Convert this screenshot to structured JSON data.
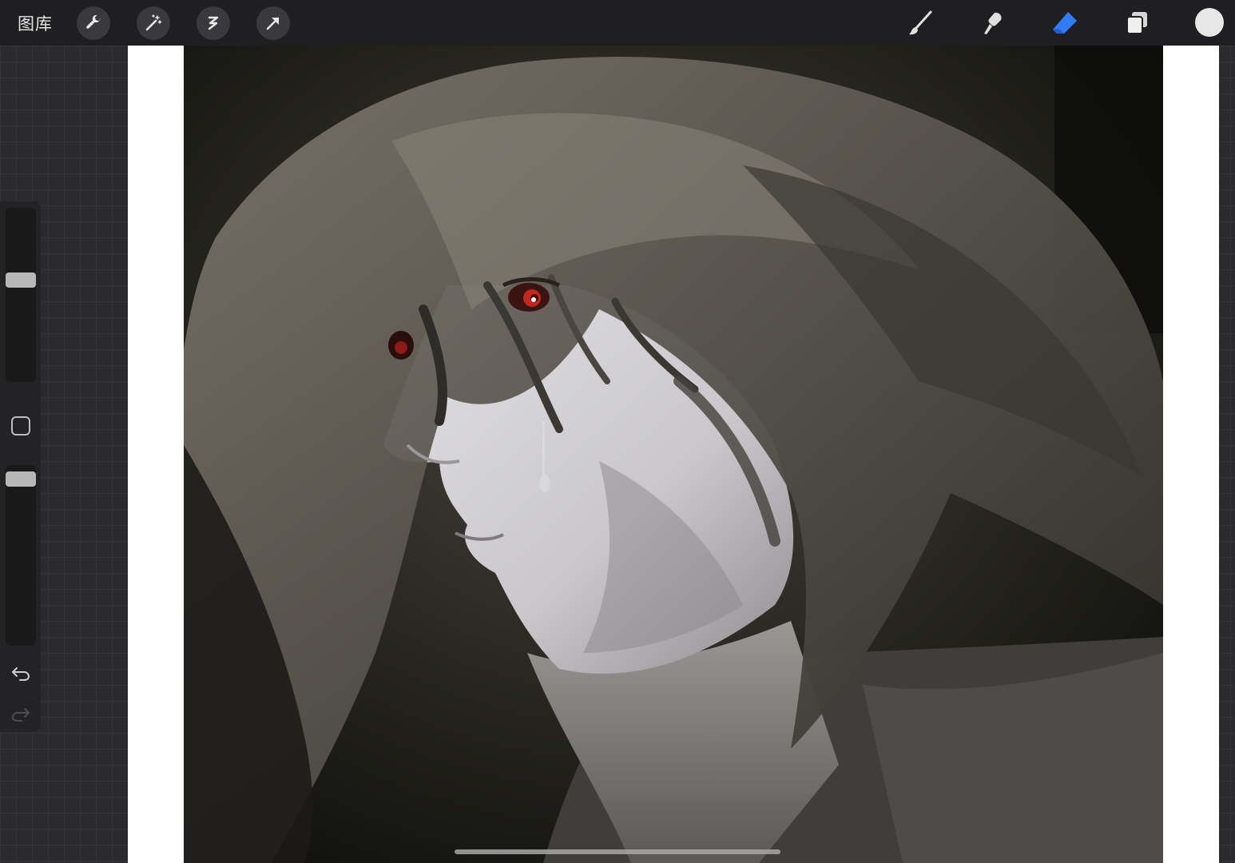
{
  "toolbar": {
    "gallery_label": "图库",
    "left_tools": [
      {
        "name": "actions",
        "icon": "wrench-icon"
      },
      {
        "name": "adjustments",
        "icon": "magic-wand-icon"
      },
      {
        "name": "selection",
        "icon": "selection-s-icon"
      },
      {
        "name": "transform",
        "icon": "arrow-cursor-icon"
      }
    ],
    "right_tools": [
      {
        "name": "brush",
        "icon": "brush-icon",
        "active": false
      },
      {
        "name": "smudge",
        "icon": "smudge-icon",
        "active": false
      },
      {
        "name": "eraser",
        "icon": "eraser-icon",
        "active": true
      },
      {
        "name": "layers",
        "icon": "layers-icon",
        "active": false
      }
    ],
    "current_color": "#e7e7e7",
    "active_tool_color": "#2f7cf6"
  },
  "sidebar": {
    "brush_size_level": 0.41,
    "opacity_level": 0.95,
    "modify_icon": "square-icon",
    "undo_icon": "undo-icon",
    "redo_icon": "redo-icon"
  },
  "canvas": {
    "subject": "portrait-painting"
  }
}
